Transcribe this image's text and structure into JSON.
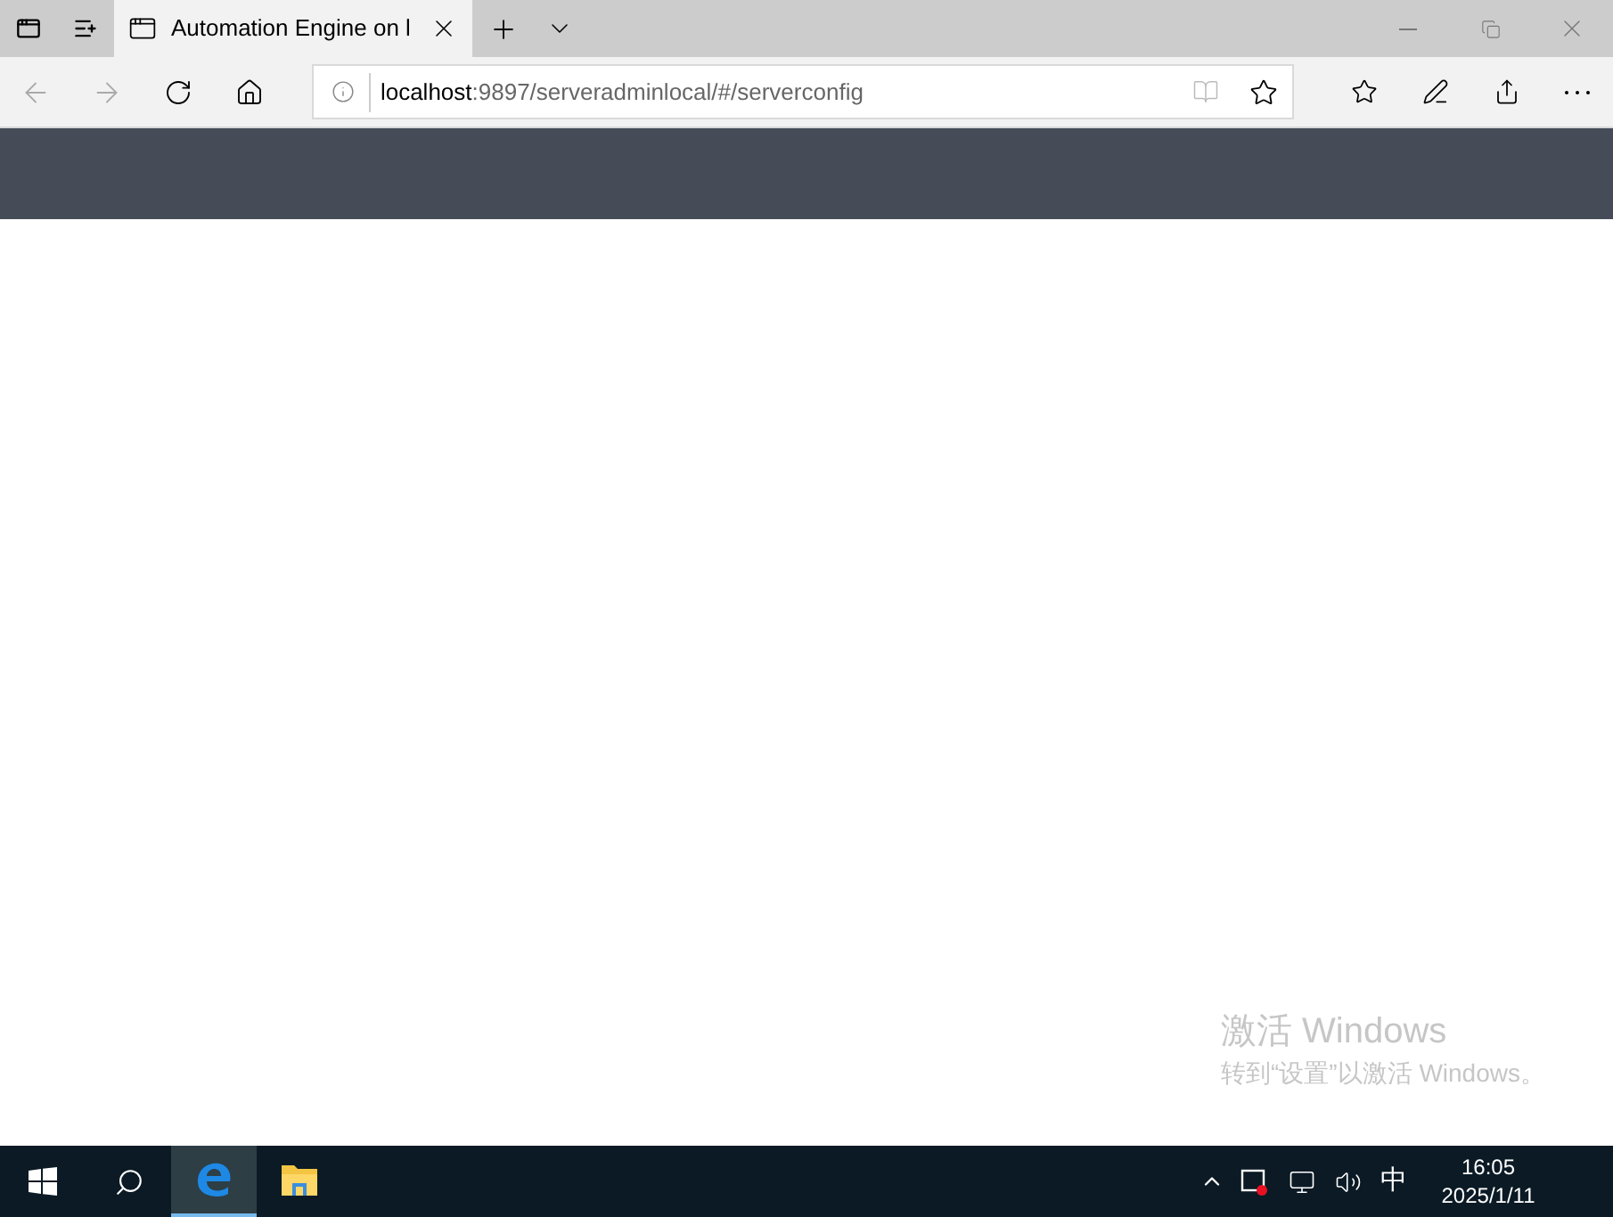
{
  "browser": {
    "tabs": [
      {
        "title": "Automation Engine on l",
        "selected": true
      }
    ],
    "address": {
      "host": "localhost",
      "path": ":9897/serveradminlocal/#/serverconfig"
    }
  },
  "activation": {
    "title": "激活 Windows",
    "message": "转到“设置”以激活 Windows。"
  },
  "taskbar": {
    "apps": [
      {
        "kind": "edge",
        "selected": true
      },
      {
        "kind": "explorer",
        "selected": false
      }
    ],
    "tray": {
      "ime": "中",
      "time": "16:05",
      "date": "2025/1/11"
    }
  }
}
